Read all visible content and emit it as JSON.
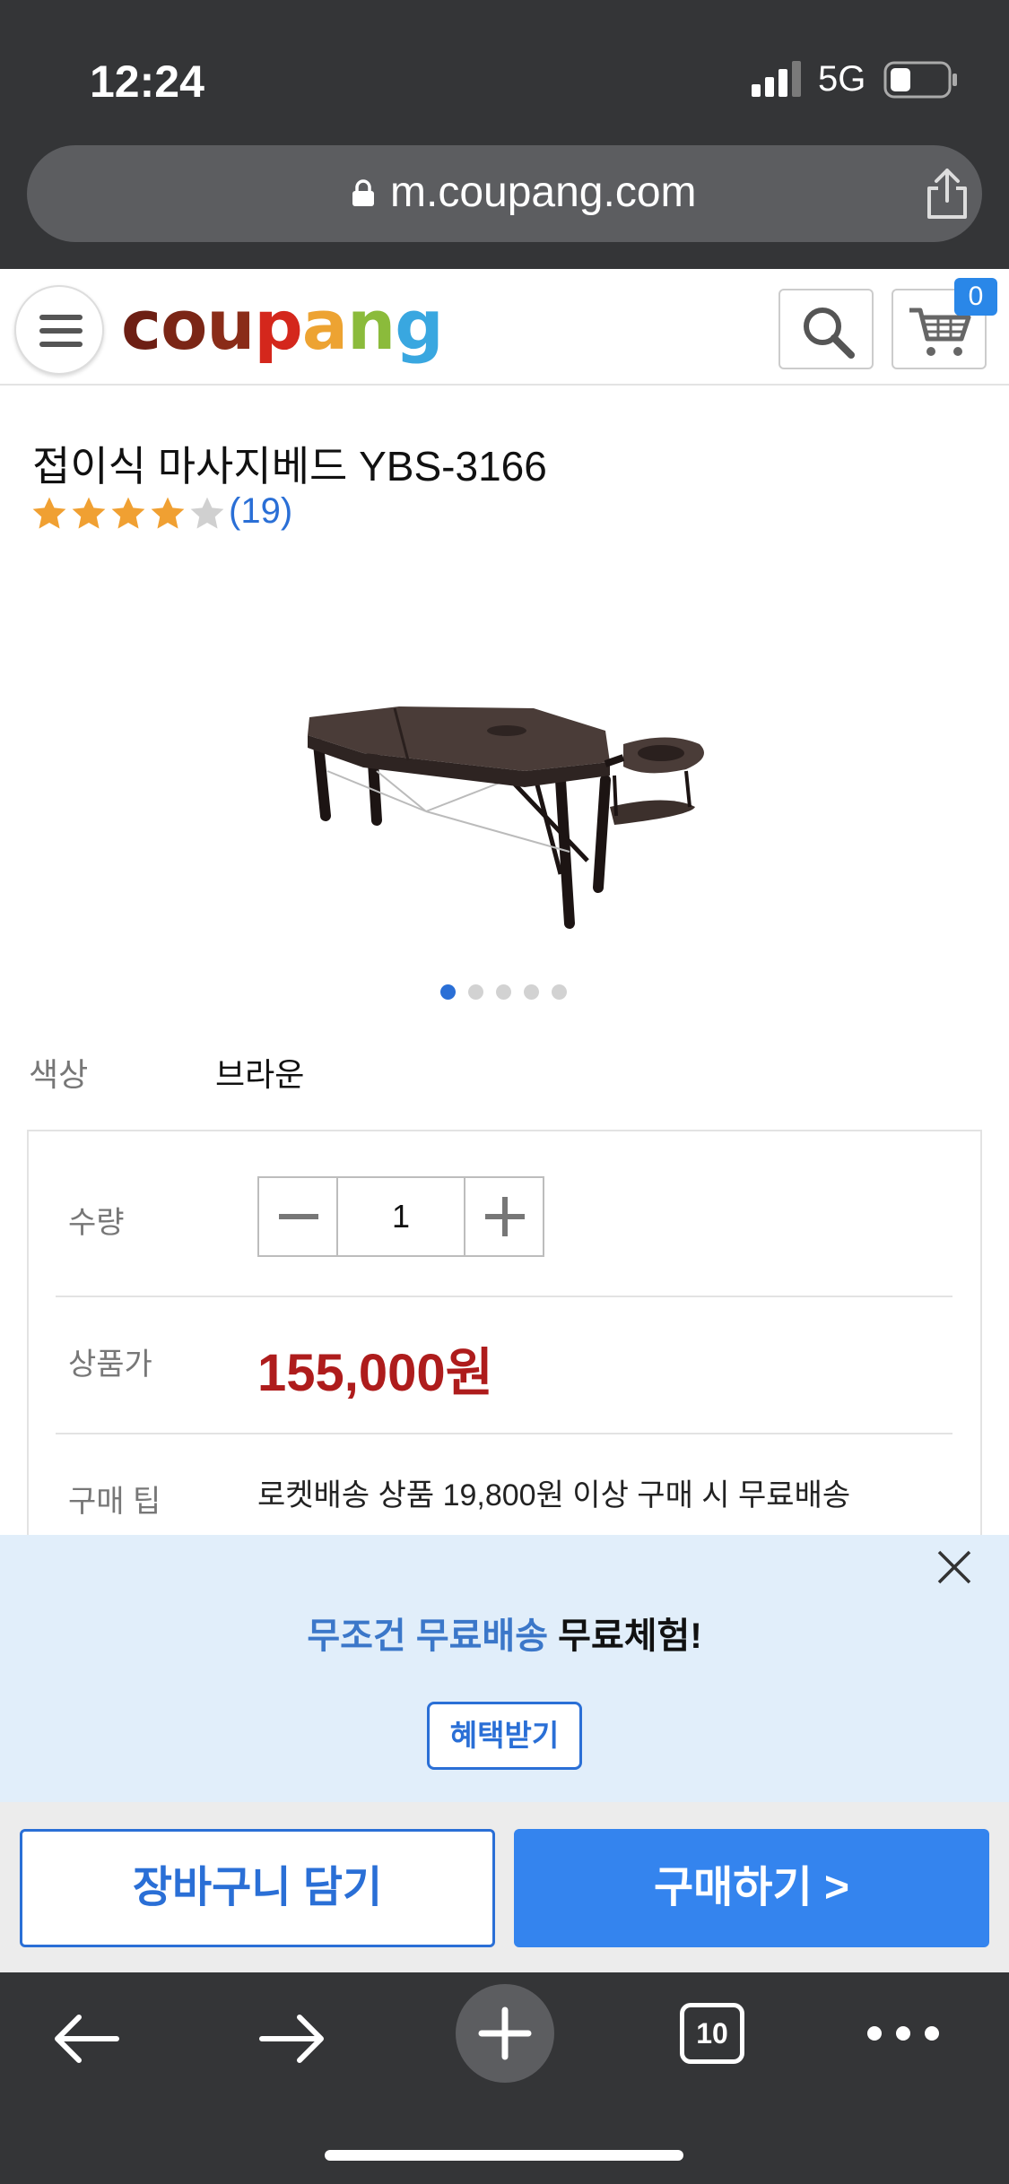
{
  "status_bar": {
    "time": "12:24",
    "network": "5G"
  },
  "browser": {
    "url": "m.coupang.com"
  },
  "header": {
    "logo_letters": [
      {
        "ch": "c",
        "color": "#6d1f14"
      },
      {
        "ch": "o",
        "color": "#7b2616"
      },
      {
        "ch": "u",
        "color": "#8a2c18"
      },
      {
        "ch": "p",
        "color": "#d4271c"
      },
      {
        "ch": "a",
        "color": "#eda332"
      },
      {
        "ch": "n",
        "color": "#8bbb3b"
      },
      {
        "ch": "g",
        "color": "#39a7e0"
      }
    ],
    "cart_count": "0"
  },
  "product": {
    "title": "접이식 마사지베드 YBS-3166",
    "rating": 4,
    "rating_max": 5,
    "review_count": "(19)",
    "image_icon": "massage-table-image",
    "image_count": 5,
    "image_index": 1,
    "color_label": "색상",
    "color_value": "브라운"
  },
  "options": {
    "qty_label": "수량",
    "qty_value": "1",
    "price_label": "상품가",
    "price": "155,000원",
    "tip_label": "구매 팁",
    "tip_text": "로켓배송 상품 19,800원 이상 구매 시 무료배송"
  },
  "promo": {
    "highlight": "무조건 무료배송",
    "rest": " 무료체험!",
    "button": "혜택받기"
  },
  "actions": {
    "add_to_cart": "장바구니 담기",
    "buy_now": "구매하기 >"
  },
  "toolbar": {
    "tab_count": "10"
  },
  "colors": {
    "accent": "#2a6fd6",
    "price": "#ae1c1c",
    "buy": "#3484ee",
    "star": "#f0a032"
  }
}
